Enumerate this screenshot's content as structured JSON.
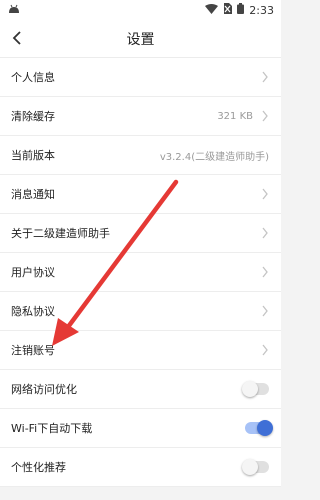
{
  "statusbar": {
    "time": "2:33"
  },
  "header": {
    "title": "设置"
  },
  "settings": [
    {
      "label": "个人信息",
      "value": "",
      "control": "chevron"
    },
    {
      "label": "清除缓存",
      "value": "321 KB",
      "control": "chevron"
    },
    {
      "label": "当前版本",
      "value": "v3.2.4(二级建造师助手)",
      "control": "none"
    },
    {
      "label": "消息通知",
      "value": "",
      "control": "chevron"
    },
    {
      "label": "关于二级建造师助手",
      "value": "",
      "control": "chevron"
    },
    {
      "label": "用户协议",
      "value": "",
      "control": "chevron"
    },
    {
      "label": "隐私协议",
      "value": "",
      "control": "chevron"
    },
    {
      "label": "注销账号",
      "value": "",
      "control": "chevron"
    },
    {
      "label": "网络访问优化",
      "control": "toggle",
      "on": false
    },
    {
      "label": "Wi-Fi下自动下载",
      "control": "toggle",
      "on": true
    },
    {
      "label": "个性化推荐",
      "control": "toggle",
      "on": false
    }
  ],
  "colors": {
    "accent": "#3f6fd6",
    "annotation_arrow": "#e53935"
  }
}
